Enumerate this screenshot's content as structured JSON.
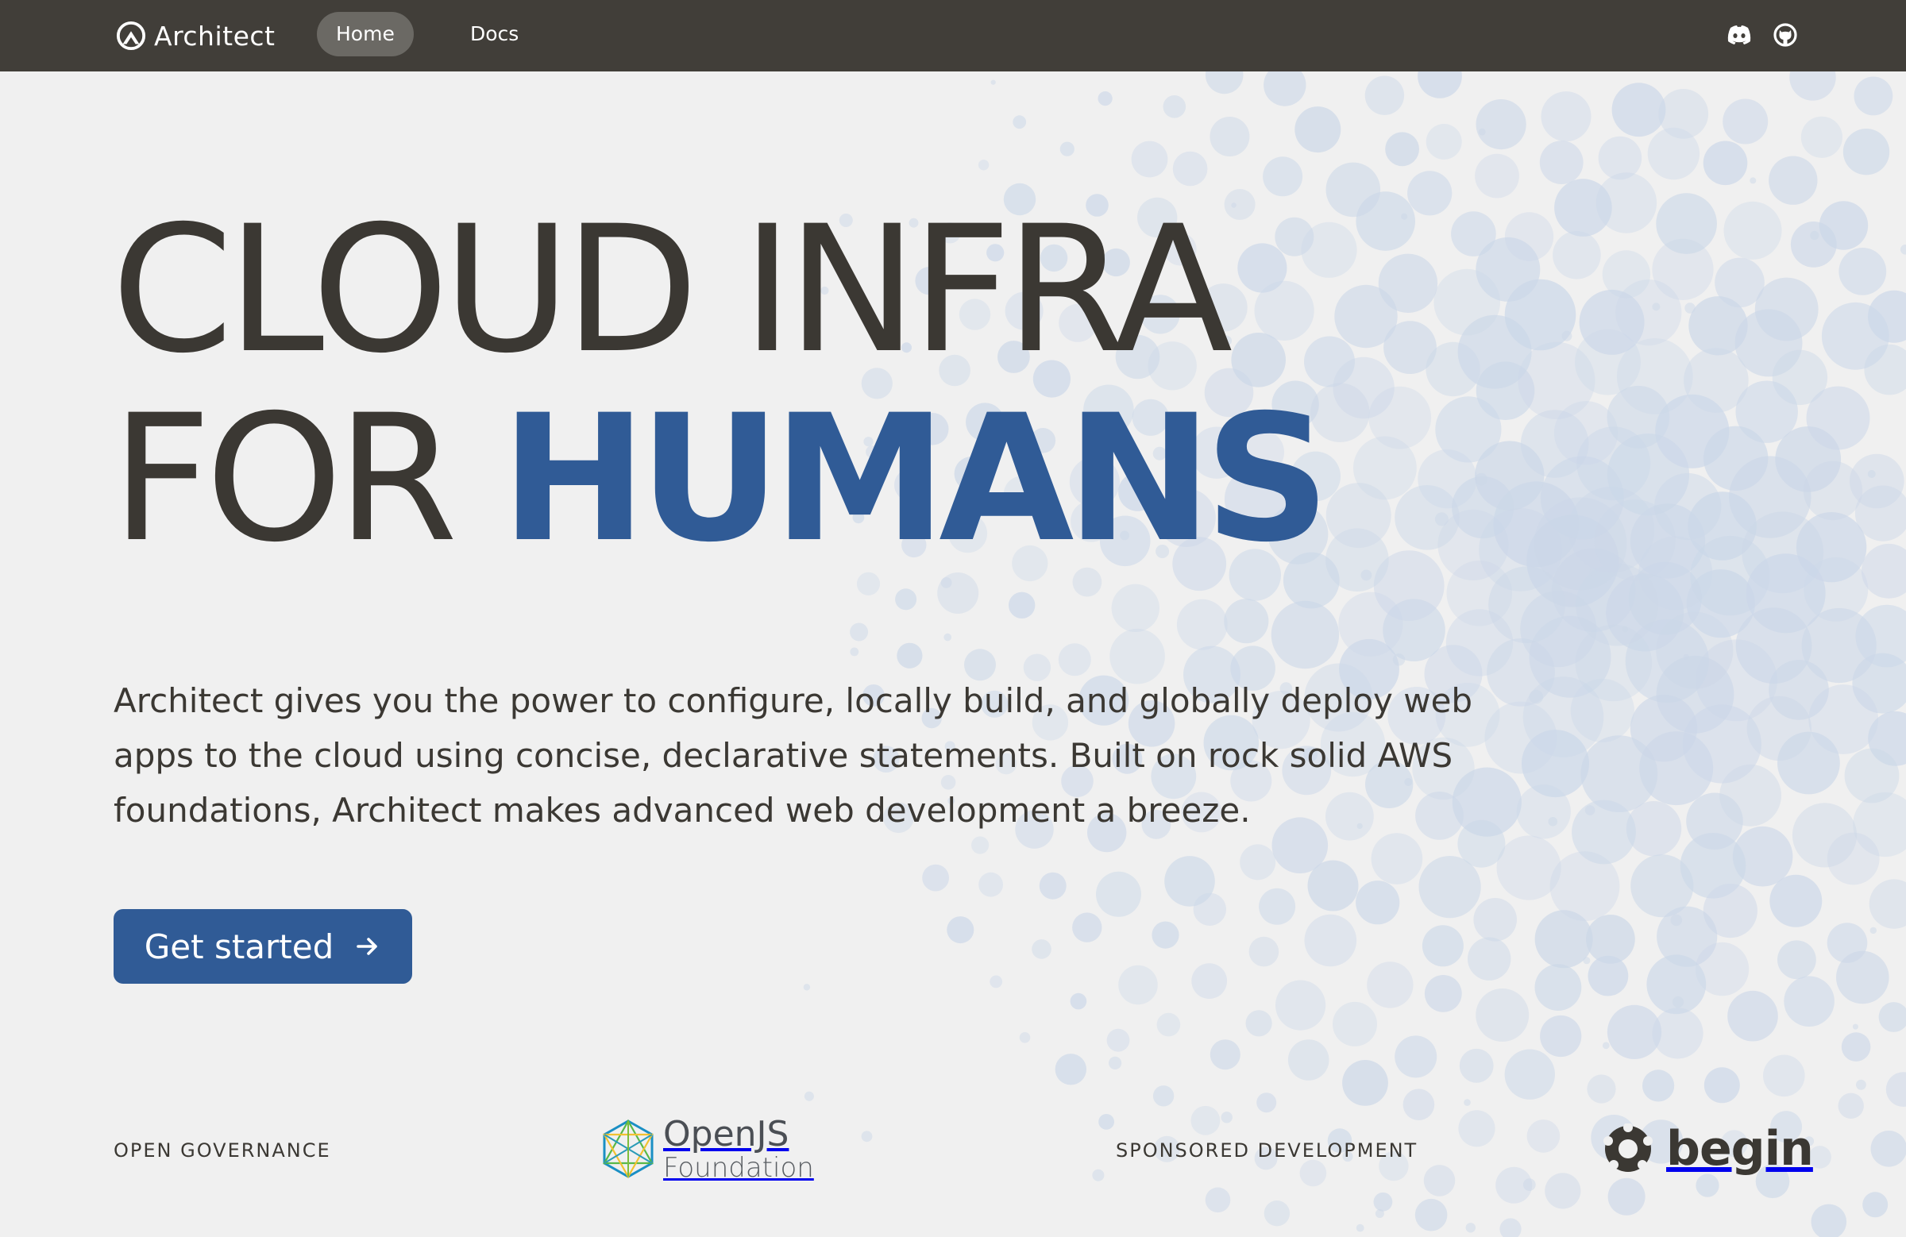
{
  "nav": {
    "brand": "Architect",
    "links": [
      {
        "label": "Home",
        "active": true
      },
      {
        "label": "Docs",
        "active": false
      }
    ],
    "icons": [
      "discord-icon",
      "github-icon"
    ],
    "background": "#413e39",
    "active_pill": "#6b6964"
  },
  "hero": {
    "line1": "CLOUD INFRA",
    "line2_prefix": "FOR",
    "line2_accent": "HUMANS",
    "text": "Architect gives you the power to configure, locally build, and globally deploy web apps to the cloud using concise, declarative statements. Built on rock solid AWS foundations, Architect makes advanced web development a breeze.",
    "cta_label": "Get started",
    "cta_icon": "arrow-right-icon",
    "accent_color": "#305b96",
    "text_color": "#3b3833"
  },
  "footer": {
    "governance_label": "OPEN GOVERNANCE",
    "openjs_name": "OpenJS",
    "openjs_sub": "Foundation",
    "sponsored_label": "SPONSORED DEVELOPMENT",
    "begin_name": "begin"
  }
}
